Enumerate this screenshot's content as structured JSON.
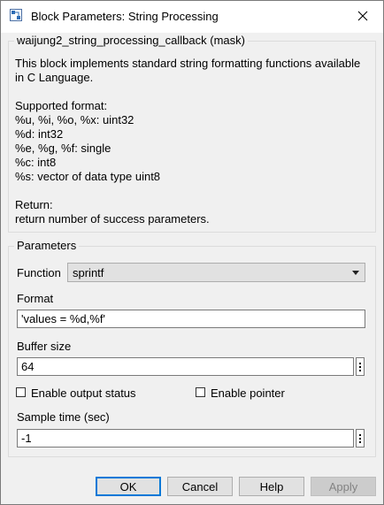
{
  "window": {
    "title": "Block Parameters: String Processing",
    "icon": "simulink-block-icon",
    "close_icon": "close-icon"
  },
  "mask": {
    "legend": "waijung2_string_processing_callback (mask)",
    "description": [
      "This block implements standard string formatting functions available",
      "in C Language.",
      "",
      "Supported format:",
      "%u, %i, %o, %x: uint32",
      "%d: int32",
      "%e, %g, %f: single",
      "%c: int8",
      "%s: vector of data type uint8",
      "",
      "Return:",
      "return number of success parameters."
    ]
  },
  "parameters": {
    "legend": "Parameters",
    "function_label": "Function",
    "function_value": "sprintf",
    "format_label": "Format",
    "format_value": "'values = %d,%f'",
    "buffer_label": "Buffer size",
    "buffer_value": "64",
    "enable_output_status_label": "Enable output status",
    "enable_output_status_checked": false,
    "enable_pointer_label": "Enable pointer",
    "enable_pointer_checked": false,
    "sample_time_label": "Sample time (sec)",
    "sample_time_value": "-1"
  },
  "buttons": {
    "ok": "OK",
    "cancel": "Cancel",
    "help": "Help",
    "apply": "Apply"
  },
  "colors": {
    "window_bg": "#f0f0f0",
    "default_button_border": "#0078d7",
    "disabled_button_bg": "#cccccc"
  }
}
